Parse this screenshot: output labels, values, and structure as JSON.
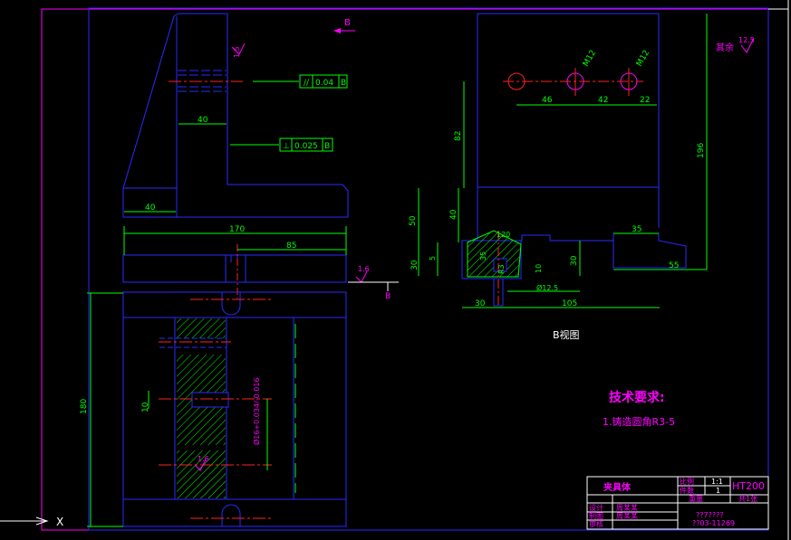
{
  "colors": {
    "background": "#000000",
    "outline": "#2a2aff",
    "dimension": "#00ff00",
    "center_line": "#ff2222",
    "annotation": "#ff00ff",
    "text_light": "#ffffff",
    "frame": "#ff00ff",
    "hatch": "#00ff00"
  },
  "view_label_b": "B",
  "section_b_label": "B",
  "rear_view_label": "B视图",
  "tech_requirements": {
    "title": "技术要求:",
    "item1": "1.铸造圆角R3-5"
  },
  "remaining_roughness": {
    "label": "其余",
    "value": "12.5"
  },
  "tolerance_frames": [
    {
      "symbol": "//",
      "value": "0.04",
      "datum": "B"
    },
    {
      "symbol": "⊥",
      "value": "0.025",
      "datum": "B"
    }
  ],
  "surface_finish": {
    "top_side": "1.5",
    "right_bottom": "1.6",
    "section": "1.6"
  },
  "dimensions_left_view": {
    "d40_upper": "40",
    "d40_lower": "40",
    "d170": "170",
    "d85": "85",
    "d180": "180",
    "d10": "10",
    "fit": "Ø16+0.034/-0.016"
  },
  "dimensions_right_view": {
    "m12_a": "M12",
    "m12_b": "M12",
    "d46": "46",
    "d42": "42",
    "d22": "22",
    "d196": "196",
    "d82": "82",
    "d50": "50",
    "d40": "40",
    "d30_left": "30",
    "d5": "5",
    "r20": "120",
    "d35_small": "35",
    "d10b": "10",
    "r3": "R3",
    "phi12": "Ø12.5",
    "d30_bottom": "30",
    "d105": "105",
    "d35": "35",
    "d30_right": "30",
    "d55": "55"
  },
  "title_block": {
    "part_name": "夹具体",
    "scale_label": "比例",
    "scale_value": "1:1",
    "qty_label": "件数",
    "qty_value": "1",
    "material": "HT200",
    "weight_label": "重量",
    "sheets": "共1张",
    "row_design": "设计",
    "row_drawing": "制图",
    "row_review": "审核",
    "designer": "周某某",
    "drawer": "周某某",
    "code1": "??7????",
    "code2": "??03-11269"
  },
  "ucs": {
    "x_label": "X"
  }
}
